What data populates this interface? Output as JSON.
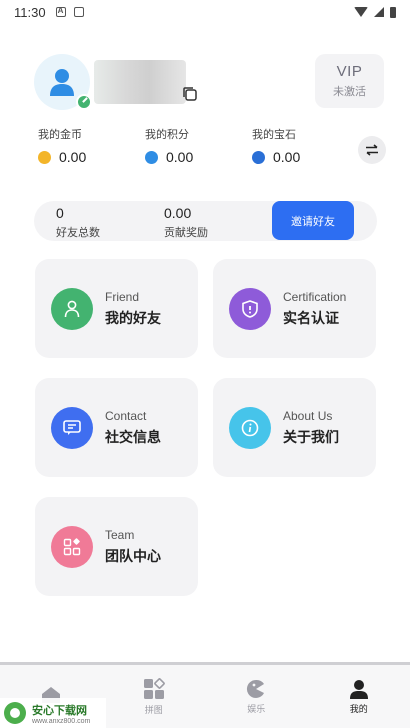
{
  "status_bar": {
    "time": "11:30"
  },
  "profile": {
    "vip_label": "VIP",
    "vip_status": "未激活"
  },
  "wallet": [
    {
      "label": "我的金币",
      "value": "0.00",
      "coin_color": "#f3b52a"
    },
    {
      "label": "我的积分",
      "value": "0.00",
      "coin_color": "#2f8de4"
    },
    {
      "label": "我的宝石",
      "value": "0.00",
      "coin_color": "#2a6fd6"
    }
  ],
  "summary": {
    "friends_count": "0",
    "friends_label": "好友总数",
    "reward_value": "0.00",
    "reward_label": "贡献奖励",
    "invite_label": "邀请好友"
  },
  "cards": [
    {
      "en": "Friend",
      "cn": "我的好友",
      "color": "#43b370",
      "icon": "person-icon"
    },
    {
      "en": "Certification",
      "cn": "实名认证",
      "color": "#8e5bd9",
      "icon": "shield-icon"
    },
    {
      "en": "Contact",
      "cn": "社交信息",
      "color": "#3f6ef0",
      "icon": "chat-icon"
    },
    {
      "en": "About Us",
      "cn": "关于我们",
      "color": "#46c4ea",
      "icon": "info-icon"
    },
    {
      "en": "Team",
      "cn": "团队中心",
      "color": "#f07a97",
      "icon": "team-grid-icon"
    }
  ],
  "nav": [
    {
      "label": "",
      "icon": "home-icon"
    },
    {
      "label": "拼图",
      "icon": "puzzle-icon"
    },
    {
      "label": "娱乐",
      "icon": "game-icon"
    },
    {
      "label": "我的",
      "icon": "profile-icon",
      "active": true
    }
  ],
  "watermark": {
    "title": "安心下载网",
    "url": "www.anxz800.com"
  }
}
